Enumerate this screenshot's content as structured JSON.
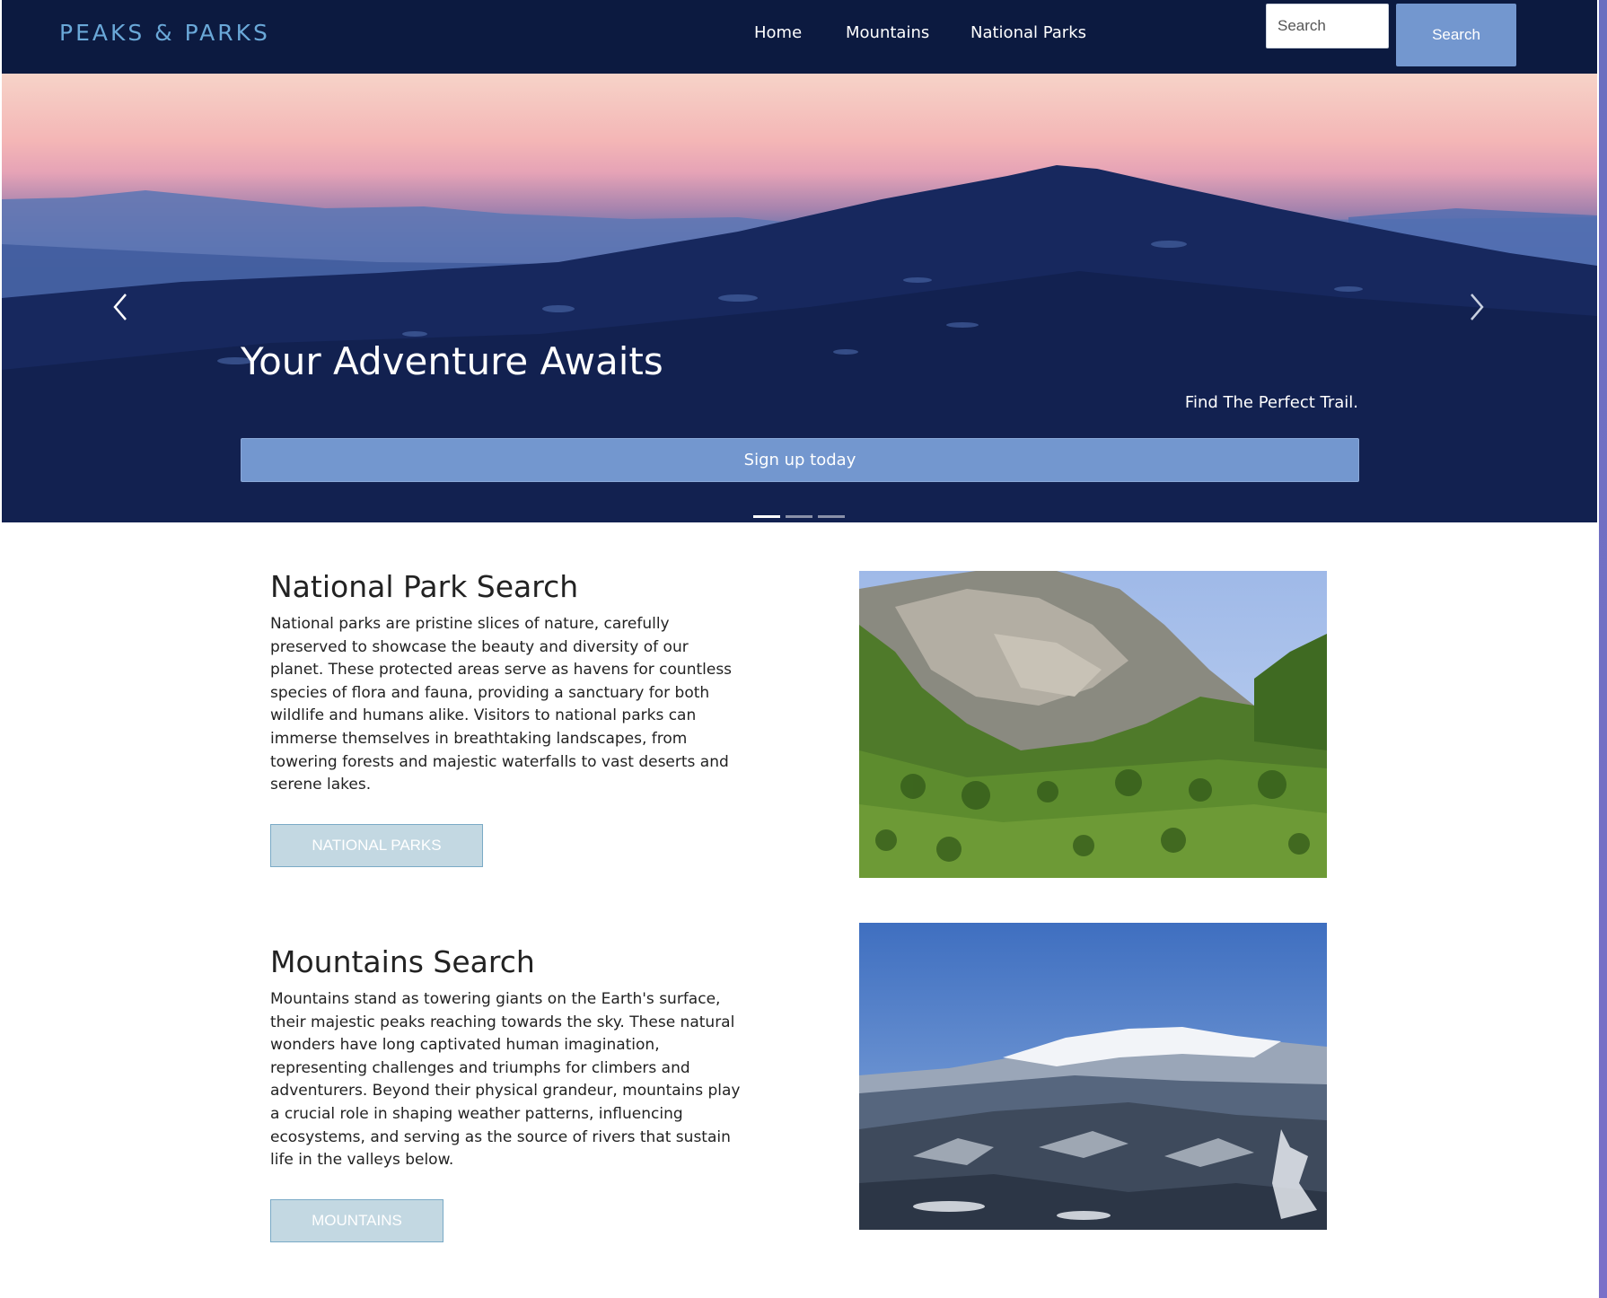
{
  "navbar": {
    "brand": "PEAKS & PARKS",
    "links": [
      {
        "label": "Home"
      },
      {
        "label": "Mountains"
      },
      {
        "label": "National Parks"
      }
    ],
    "search": {
      "placeholder": "Search",
      "button_label": "Search"
    }
  },
  "hero": {
    "title": "Your Adventure Awaits",
    "subtitle": "Find The Perfect Trail.",
    "cta_label": "Sign up today",
    "slide_count": 3,
    "active_slide": 1
  },
  "sections": [
    {
      "title": "National Park Search",
      "text": "National parks are pristine slices of nature, carefully preserved to showcase the beauty and diversity of our planet. These protected areas serve as havens for countless species of flora and fauna, providing a sanctuary for both wildlife and humans alike. Visitors to national parks can immerse themselves in breathtaking landscapes, from towering forests and majestic waterfalls to vast deserts and serene lakes.",
      "button_label": "NATIONAL PARKS"
    },
    {
      "title": "Mountains Search",
      "text": "Mountains stand as towering giants on the Earth's surface, their majestic peaks reaching towards the sky. These natural wonders have long captivated human imagination, representing challenges and triumphs for climbers and adventurers. Beyond their physical grandeur, mountains play a crucial role in shaping weather patterns, influencing ecosystems, and serving as the source of rivers that sustain life in the valleys below.",
      "button_label": "MOUNTAINS"
    }
  ],
  "colors": {
    "navbar_bg": "#0c1a40",
    "brand": "#6aa8d8",
    "accent_button": "#7397cf",
    "section_button_bg": "#c3d8e2",
    "section_button_border": "#7aaac6"
  }
}
